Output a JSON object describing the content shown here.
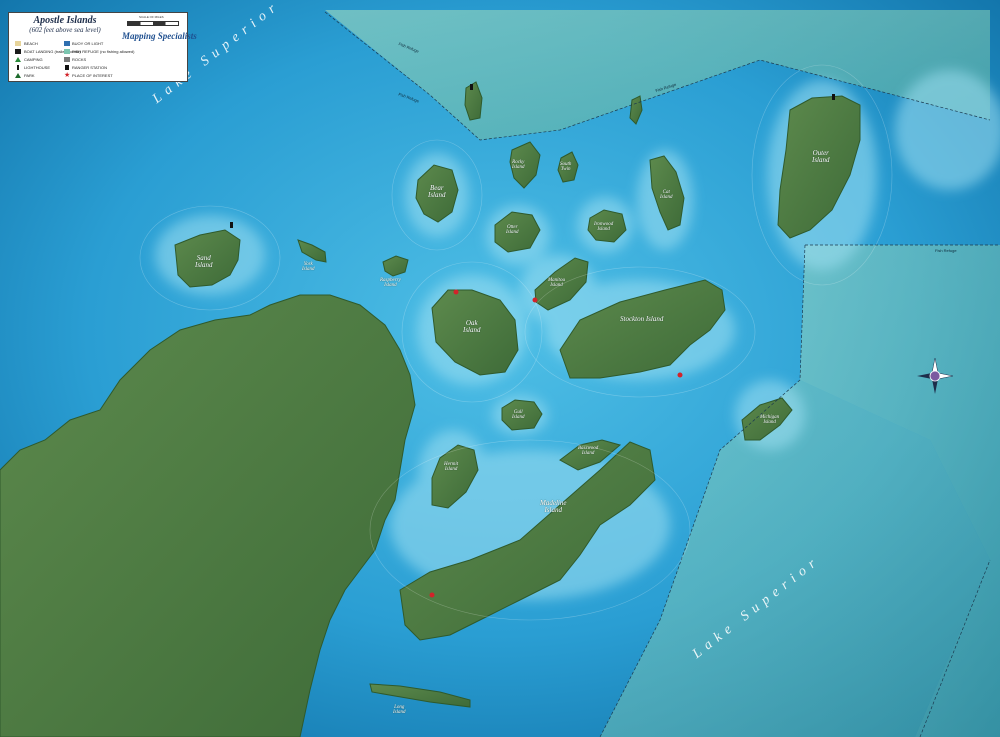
{
  "map": {
    "legend": {
      "title": "Apostle Islands",
      "subtitle": "(602 feet above sea level)",
      "items_left": [
        "BEACH",
        "BOAT LANDING (trailer access)",
        "CAMPING",
        "LIGHTHOUSE",
        "PARK"
      ],
      "items_right": [
        "BUOY OR LIGHT",
        "FISH REFUGE (no fishing allowed)",
        "ROCKS",
        "RANGER STATION",
        "PLACE OF INTEREST"
      ],
      "brand": "Mapping Specialists",
      "scale_label": "SCALE OF MILES"
    },
    "lake_labels": [
      {
        "id": "lake-nw",
        "text": "Lake  Superior"
      },
      {
        "id": "lake-se",
        "text": "Lake  Superior"
      }
    ],
    "islands": [
      {
        "id": "sand",
        "label": "Sand\nIsland"
      },
      {
        "id": "york",
        "label": "York\nIsland"
      },
      {
        "id": "raspberry",
        "label": "Raspberry\nIsland"
      },
      {
        "id": "bear",
        "label": "Bear\nIsland"
      },
      {
        "id": "rocky",
        "label": "Rocky\nIsland"
      },
      {
        "id": "south-twin",
        "label": "South\nTwin"
      },
      {
        "id": "otter",
        "label": "Otter\nIsland"
      },
      {
        "id": "ironwood",
        "label": "Ironwood\nIsland"
      },
      {
        "id": "cat",
        "label": "Cat\nIsland"
      },
      {
        "id": "outer",
        "label": "Outer\nIsland"
      },
      {
        "id": "manitou",
        "label": "Manitou\nIsland"
      },
      {
        "id": "oak",
        "label": "Oak\nIsland"
      },
      {
        "id": "stockton",
        "label": "Stockton Island"
      },
      {
        "id": "gull",
        "label": "Gull\nIsland"
      },
      {
        "id": "hermit",
        "label": "Hermit\nIsland"
      },
      {
        "id": "basswood",
        "label": "Basswood\nIsland"
      },
      {
        "id": "madeline",
        "label": "Madeline\nIsland"
      },
      {
        "id": "michigan",
        "label": "Michigan\nIsland"
      },
      {
        "id": "long",
        "label": "Long\nIsland"
      }
    ],
    "fish_refuge_labels": [
      "Fish Refuge",
      "Fish Refuge",
      "Fish Refuge",
      "Fish Refuge"
    ],
    "colors": {
      "deep_water": "#0b6fa5",
      "shallow_water": "#5ec5ea",
      "land": "#4e7a43",
      "refuge_zone": "#7cc6b0"
    }
  }
}
